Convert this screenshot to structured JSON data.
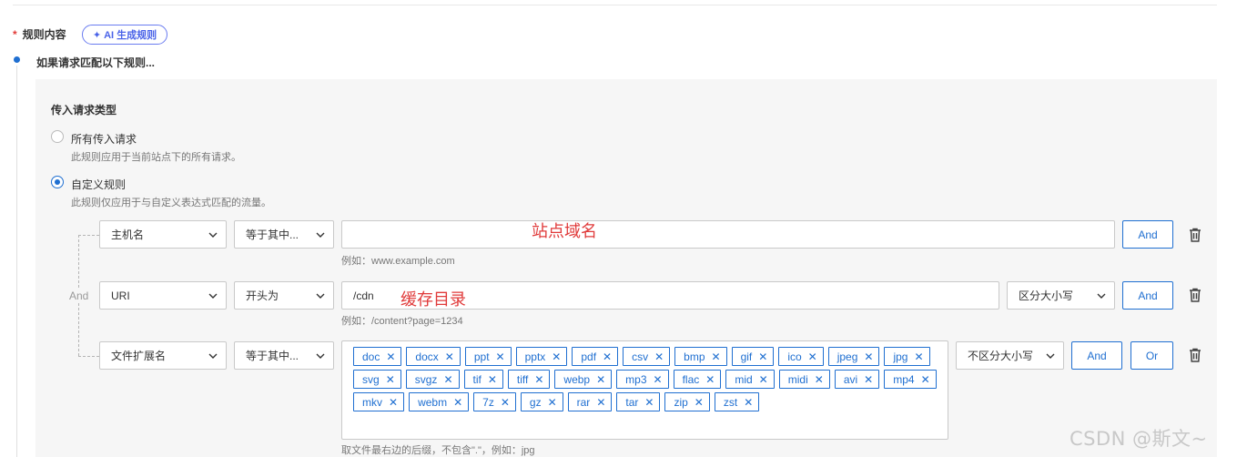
{
  "header": {
    "required_mark": "*",
    "rule_content_label": "规则内容",
    "ai_button_label": "AI 生成规则",
    "if_title": "如果请求匹配以下规则..."
  },
  "request_type": {
    "title": "传入请求类型",
    "options": [
      {
        "label": "所有传入请求",
        "desc": "此规则应用于当前站点下的所有请求。",
        "selected": false
      },
      {
        "label": "自定义规则",
        "desc": "此规则仅应用于与自定义表达式匹配的流量。",
        "selected": true
      }
    ]
  },
  "conditions": [
    {
      "field": "主机名",
      "operator": "等于其中...",
      "value": "",
      "hint": "例如：www.example.com",
      "annotation": "站点域名",
      "and_label": "And"
    },
    {
      "field": "URI",
      "operator": "开头为",
      "value": "/cdn",
      "hint": "例如：/content?page=1234",
      "annotation": "缓存目录",
      "case": "区分大小写",
      "and_label": "And"
    },
    {
      "field": "文件扩展名",
      "operator": "等于其中...",
      "tags": [
        "doc",
        "docx",
        "ppt",
        "pptx",
        "pdf",
        "csv",
        "bmp",
        "gif",
        "ico",
        "jpeg",
        "jpg",
        "svg",
        "svgz",
        "tif",
        "tiff",
        "webp",
        "mp3",
        "flac",
        "mid",
        "midi",
        "avi",
        "mp4",
        "mkv",
        "webm",
        "7z",
        "gz",
        "rar",
        "tar",
        "zip",
        "zst"
      ],
      "hint": "取文件最右边的后缀，不包含\".\"，例如：jpg",
      "case": "不区分大小写",
      "and_label": "And",
      "or_label": "Or"
    }
  ],
  "tree": {
    "connector_label": "And"
  },
  "watermark": "CSDN @斯文~",
  "colors": {
    "accent": "#1f6fd1",
    "ai_accent": "#4a63e8",
    "annotation": "#e03a3a",
    "required": "#e23c39"
  }
}
